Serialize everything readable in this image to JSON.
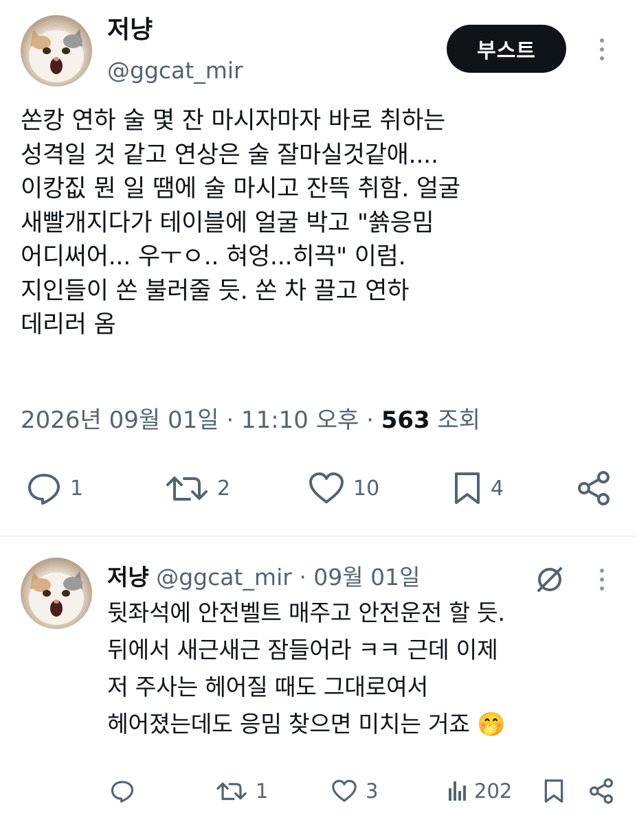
{
  "main_post": {
    "author_name": "저냥",
    "author_handle": "@ggcat_mir",
    "boost_label": "부스트",
    "text_lines": [
      "쏜캉 연하 술 몇 잔 마시자마자 바로 취하는",
      "성격일 것 같고 연상은 술 잘마실것같애....",
      "이캉짒 뭔 일 땜에 술 마시고 잔뜩 취함. 얼굴",
      "새빨개지다가 테이블에 얼굴 박고 \"쑑응밈",
      "어디써어... 우ㅜㅇ.. 혀엉...히끅\" 이럼.",
      "지인들이 쏜 불러줄 듯. 쏜 차 끌고 연하",
      "데리러 옴"
    ],
    "timestamp": "2026년 09월 01일 · 11:10 오후 · ",
    "views_count": "563",
    "views_label": " 조회",
    "actions": {
      "reply": "1",
      "retweet": "2",
      "like": "10",
      "bookmark": "4"
    }
  },
  "reply_post": {
    "author_name": "저냥",
    "author_handle": "@ggcat_mir",
    "date": " · 09월 01일",
    "text_lines": [
      "뒷좌석에 안전벨트 매주고 안전운전 할 듯.",
      "뒤에서 새근새근 잠들어라 ㅋㅋ 근데 이제",
      "저 주사는 헤어질 때도 그대로여서",
      "헤어졌는데도 응밈 찾으면 미치는 거죠"
    ],
    "emoji": "🤭",
    "actions": {
      "reply": "",
      "retweet": "1",
      "like": "3",
      "views": "202"
    }
  },
  "colors": {
    "text": "#0f1419",
    "muted": "#536471",
    "button": "#0f1419"
  }
}
